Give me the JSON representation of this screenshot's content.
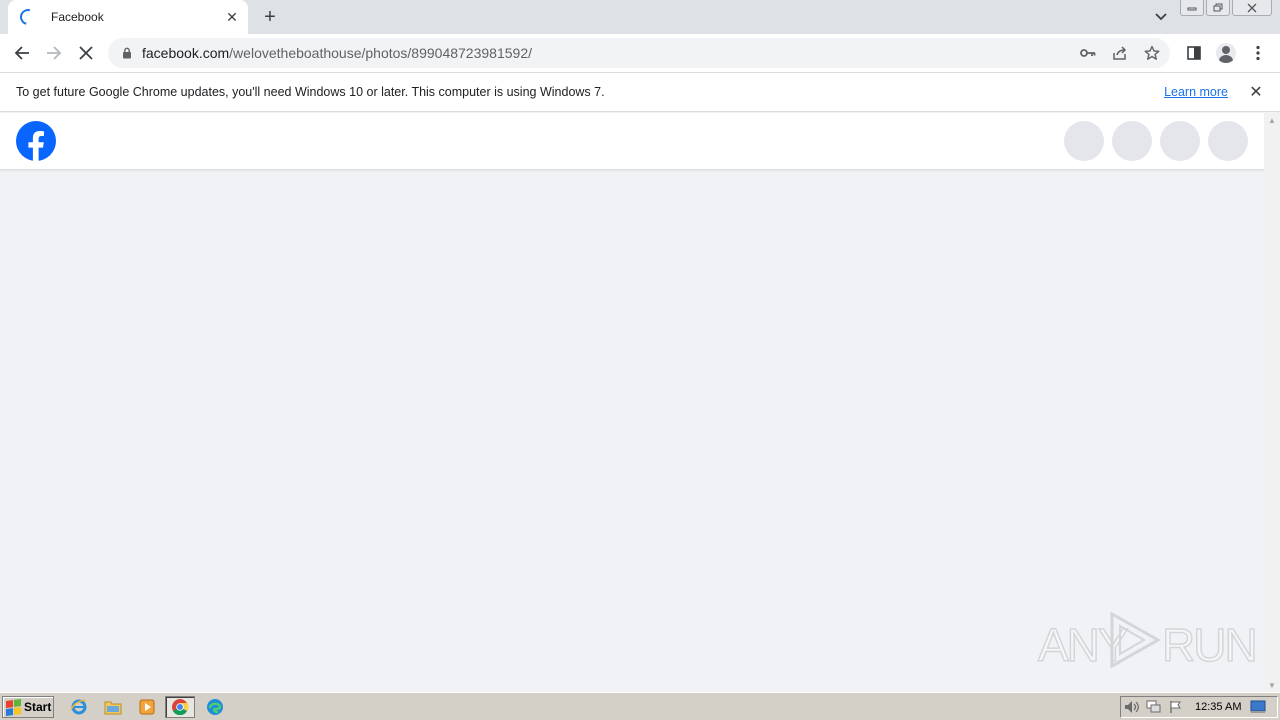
{
  "browser": {
    "tab": {
      "title": "Facebook",
      "close_glyph": "✕"
    },
    "new_tab_glyph": "+",
    "url": {
      "host": "facebook.com",
      "path": "/welovetheboathouse/photos/899048723981592/"
    }
  },
  "infobar": {
    "message": "To get future Google Chrome updates, you'll need Windows 10 or later. This computer is using Windows 7.",
    "learn_more": "Learn more",
    "close_glyph": "✕"
  },
  "page": {
    "brand_color": "#0866ff",
    "header_placeholders": 4
  },
  "watermark": {
    "text_left": "ANY",
    "text_right": "RUN"
  },
  "taskbar": {
    "start_label": "Start",
    "apps": [
      "internet-explorer-icon",
      "file-explorer-icon",
      "media-player-icon",
      "chrome-icon",
      "edge-icon"
    ],
    "clock": "12:35 AM"
  }
}
